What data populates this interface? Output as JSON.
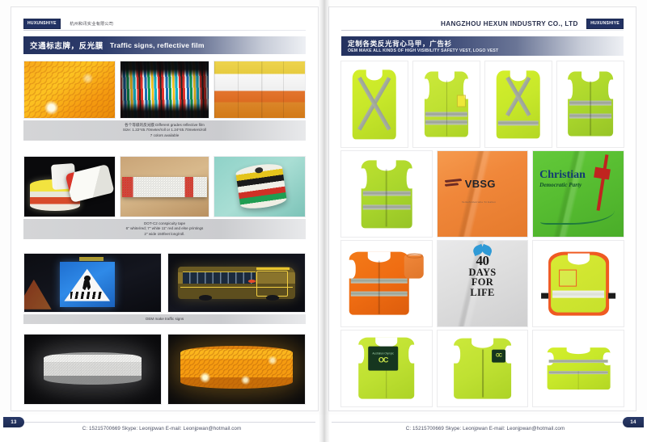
{
  "document": {
    "type": "product-catalog-spread",
    "company_en": "HANGZHOU HEXUN INDUSTRY CO., LTD",
    "company_cn": "杭州和讯实业有限公司",
    "logo_text": "HUXUNSHIYE"
  },
  "left_page": {
    "page_number": "13",
    "title_cn": "交通标志牌，反光膜",
    "title_en": "Traffic signs, reflective film",
    "sections": [
      {
        "photos": [
          {
            "name": "orange-honeycomb-reflective-film"
          },
          {
            "name": "colored-reflective-strips"
          },
          {
            "name": "reflective-sheeting-colors"
          }
        ],
        "caption": [
          "各个等级的反光膜 Different grades reflective film",
          "Size: 1.22*45.70meter/roll or 1.24*45.70meters/roll",
          "7 colors available"
        ]
      },
      {
        "photos": [
          {
            "name": "yellow-red-tape-rolls"
          },
          {
            "name": "red-white-conspicuity-tape"
          },
          {
            "name": "multicolor-tape-roll"
          }
        ],
        "caption": [
          "DOT-C2 conspicuity tape",
          "6\" white/red; 7\" white 11\" red and else printings",
          "2\" wide 150feet long/roll."
        ]
      },
      {
        "photos": [
          {
            "name": "pedestrian-crossing-sign-night"
          },
          {
            "name": "school-bus-reflective-night"
          }
        ],
        "caption": [
          "OEM make traffic signs"
        ]
      },
      {
        "photos": [
          {
            "name": "white-reflective-tape-roll"
          },
          {
            "name": "orange-reflective-tape-roll"
          }
        ],
        "caption": []
      }
    ]
  },
  "right_page": {
    "page_number": "14",
    "title_cn": "定制各类反光背心马甲，广告衫",
    "title_en": "OEM MAKE ALL KINDS OF HIGH VISIBILITY SAFETY VEST, LOGO VEST",
    "rows": [
      {
        "cells": [
          {
            "name": "vest-lime-x-back",
            "color": "#c8e82a"
          },
          {
            "name": "vest-lime-front-zip",
            "color": "#bfe132"
          },
          {
            "name": "vest-lime-x-back-2",
            "color": "#c8e82a"
          },
          {
            "name": "vest-green-two-band",
            "color": "#a9d62c"
          }
        ]
      },
      {
        "cells": [
          {
            "name": "vest-green-two-band-front",
            "color": "#bde02f"
          },
          {
            "name": "fabric-orange-vbsg-logo",
            "logo_text": "VBSG",
            "logo_sub": "Verkehrsbetriebe St.Gallen"
          },
          {
            "name": "fabric-green-christian-democratic-party",
            "logo_line1": "Christian",
            "logo_line2": "Democratic Party"
          }
        ]
      },
      {
        "cells": [
          {
            "name": "vest-orange-with-pouch",
            "color": "#ef6c12"
          },
          {
            "name": "fabric-white-40-days-for-life",
            "logo_lines": [
              "40",
              "DAYS",
              "FOR",
              "LIFE"
            ]
          },
          {
            "name": "tabard-lime-orange-trim",
            "color": "#c7e12c"
          }
        ]
      },
      {
        "cells": [
          {
            "name": "vest-lime-logo-patch-front",
            "color": "#c2e02e",
            "patch_big": "OC",
            "patch_small": "Australian Olympic"
          },
          {
            "name": "vest-lime-small-patch",
            "color": "#c2e02e",
            "patch_big": "OC"
          },
          {
            "name": "vest-lime-back-bands",
            "color": "#c9e530"
          }
        ]
      }
    ]
  },
  "footer": {
    "contact": "C: 15215700669 Skype: Leonjpwan E-mail: Leonjpwan@hotmail.com"
  }
}
